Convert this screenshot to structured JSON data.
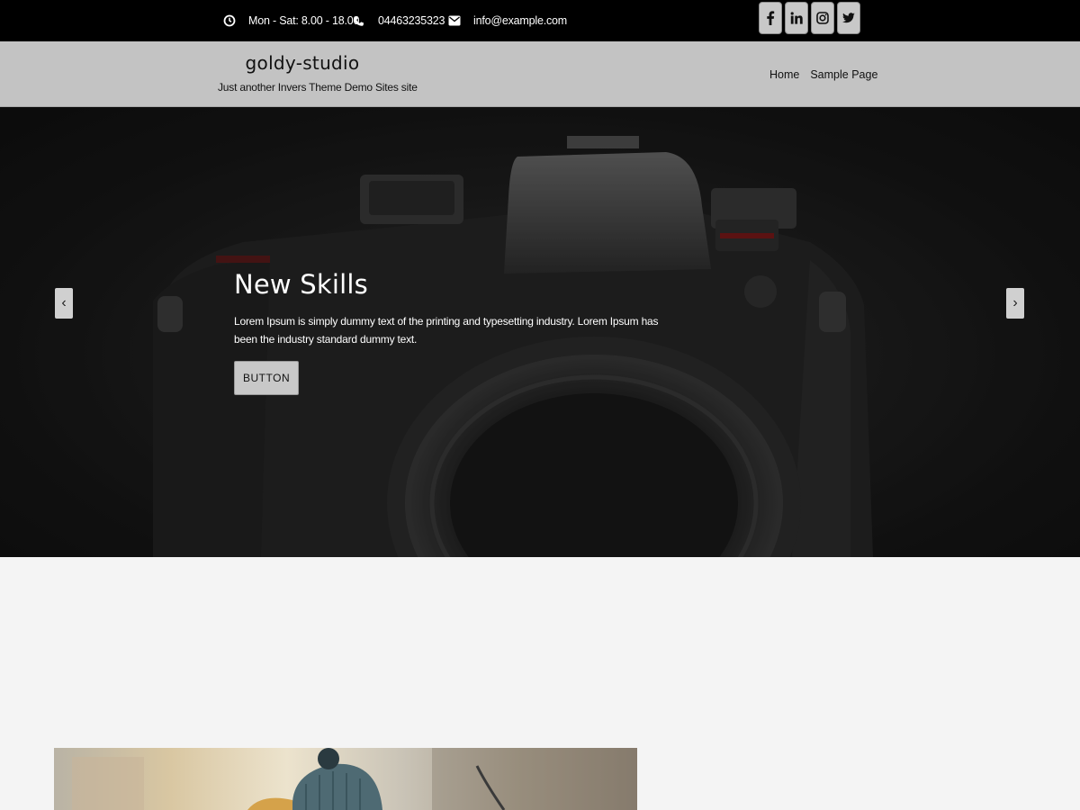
{
  "topbar": {
    "hours": "Mon - Sat: 8.00 - 18.00",
    "phone": "04463235323",
    "email": "info@example.com",
    "social": [
      {
        "name": "facebook",
        "icon": "facebook-icon"
      },
      {
        "name": "linkedin",
        "icon": "linkedin-icon"
      },
      {
        "name": "instagram",
        "icon": "instagram-icon"
      },
      {
        "name": "twitter",
        "icon": "twitter-icon"
      }
    ]
  },
  "header": {
    "site_title": "goldy-studio",
    "tagline": "Just another Invers Theme Demo Sites site",
    "nav": [
      "Home",
      "Sample Page"
    ]
  },
  "hero": {
    "title": "New Skills",
    "text": "Lorem Ipsum is simply dummy text of the printing and typesetting industry. Lorem Ipsum has been the industry standard dummy text.",
    "button": "BUTTON",
    "prev": "‹",
    "next": "›"
  },
  "colors": {
    "topbar_bg": "#000000",
    "header_bg": "#c3c3c3",
    "button_bg": "#c8c8c8",
    "page_bg": "#f4f4f4"
  }
}
